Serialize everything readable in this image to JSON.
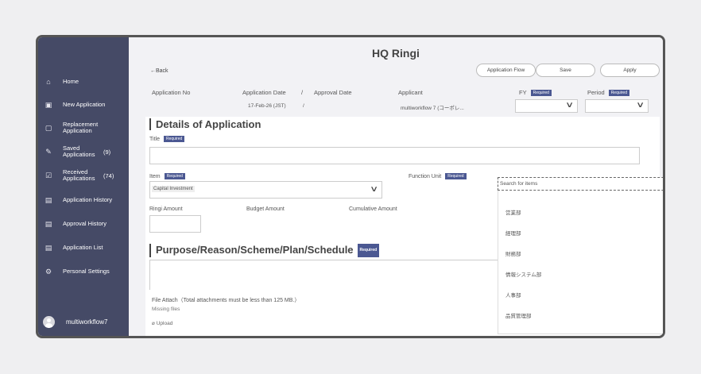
{
  "sidebar": {
    "items": [
      {
        "label": "Home",
        "icon": "home-icon",
        "glyph": "⌂"
      },
      {
        "label": "New Application",
        "icon": "new-document-icon",
        "glyph": "▣"
      },
      {
        "label": "Replacement Application",
        "icon": "document-icon",
        "glyph": "▢"
      },
      {
        "label": "Saved Applications",
        "count": "(9)",
        "icon": "saved-icon",
        "glyph": "✎"
      },
      {
        "label": "Received Applications",
        "count": "(74)",
        "icon": "received-icon",
        "glyph": "☑"
      },
      {
        "label": "Application History",
        "icon": "history-icon",
        "glyph": "▤"
      },
      {
        "label": "Approval History",
        "icon": "approval-icon",
        "glyph": "▤"
      },
      {
        "label": "Application List",
        "icon": "list-icon",
        "glyph": "▤"
      },
      {
        "label": "Personal Settings",
        "icon": "gear-icon",
        "glyph": "⚙"
      }
    ],
    "user": "multiworkflow7"
  },
  "header": {
    "title": "HQ Ringi",
    "back": "←Back",
    "buttons": {
      "flow": "Application Flow",
      "save": "Save",
      "apply": "Apply"
    }
  },
  "info": {
    "app_no_label": "Application No",
    "app_date_label": "Application Date",
    "sep": "/",
    "approval_date_label": "Approval Date",
    "applicant_label": "Applicant",
    "fy_label": "FY",
    "period_label": "Period",
    "required": "Required",
    "app_date_value": "17-Feb-26 (JST)",
    "applicant_value": "multiworkflow 7 (コーポレ..."
  },
  "details": {
    "heading": "Details of Application",
    "title_label": "Title",
    "item_label": "Item",
    "item_value": "Capital Investment",
    "function_unit_label": "Function Unit",
    "ringi_amount_label": "Ringi Amount",
    "budget_amount_label": "Budget Amount",
    "cumulative_amount_label": "Cumulative Amount",
    "purpose_heading": "Purpose/Reason/Scheme/Plan/Schedule"
  },
  "attach": {
    "label": "File Attach（Total attachments must be less than 125 MB.）",
    "missing": "Missing files",
    "upload": "Upload"
  },
  "dropdown": {
    "placeholder": "Search for items",
    "options": [
      "営業部",
      "経理部",
      "財務部",
      "情報システム部",
      "人事部",
      "品質管理部"
    ]
  },
  "colors": {
    "sidebar": "#454a66",
    "badge": "#4b5892"
  }
}
